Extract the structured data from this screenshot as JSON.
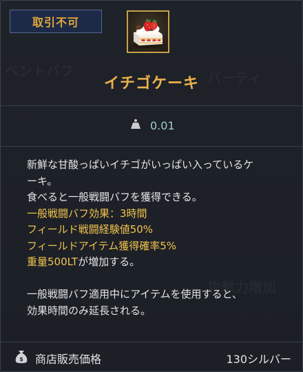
{
  "badge": {
    "label": "取引不可"
  },
  "item": {
    "name": "イチゴケーキ",
    "icon": "strawberry-cake-icon"
  },
  "weight": {
    "icon": "weight-icon",
    "value": "0.01"
  },
  "description": {
    "lines": [
      {
        "text": "新鮮な甘酸っぱいイチゴがいっぱい入っているケ",
        "highlight": false
      },
      {
        "text": "ーキ。",
        "highlight": false
      },
      {
        "text": "食べると一般戦闘バフを獲得できる。",
        "highlight": false
      },
      {
        "text": "一般戦闘バフ効果：3時間",
        "highlight": true
      },
      {
        "text": "フィールド戦闘経験値50%",
        "highlight": true
      },
      {
        "text": "フィールドアイテム獲得確率5%",
        "highlight": true
      },
      {
        "text": "重量500LT",
        "highlight": true
      },
      {
        "text": "",
        "highlight": false
      },
      {
        "text": "一般戦闘バフ適用中にアイテムを使用すると、",
        "highlight": false
      },
      {
        "text": "効果時間のみ延長される。",
        "highlight": false
      }
    ],
    "weight_suffix": "が増加する。"
  },
  "shop": {
    "icon": "money-bag-icon",
    "label": "商店販売価格",
    "price": "130シルバー"
  },
  "colors": {
    "gold": "#f0c34e",
    "title": "#ecb24c",
    "weight_value": "#9fd0cc",
    "badge_bg": "#1d2a47"
  }
}
